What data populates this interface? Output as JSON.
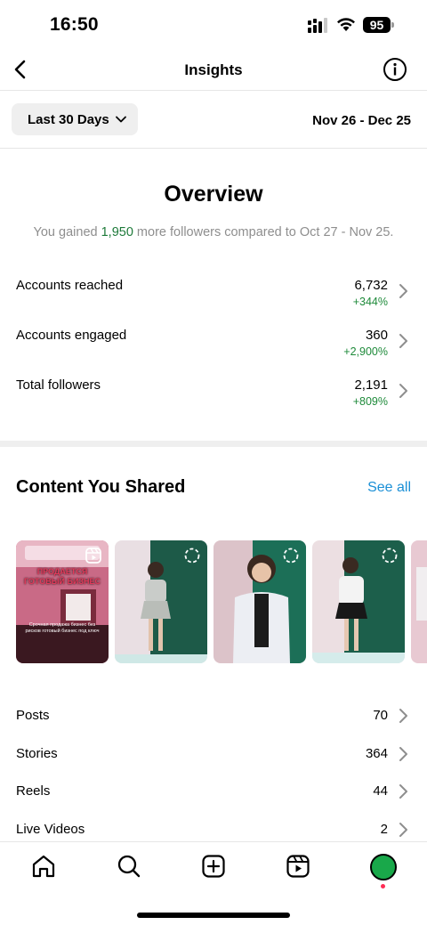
{
  "status_bar": {
    "time": "16:50",
    "battery": "95"
  },
  "header": {
    "title": "Insights"
  },
  "filter": {
    "range_label": "Last 30 Days",
    "date_range": "Nov 26 - Dec 25"
  },
  "overview": {
    "title": "Overview",
    "sub_prefix": "You gained ",
    "sub_highlight": "1,950",
    "sub_suffix": " more followers compared to Oct 27 - Nov 25.",
    "metrics": [
      {
        "label": "Accounts reached",
        "value": "6,732",
        "change": "+344%"
      },
      {
        "label": "Accounts engaged",
        "value": "360",
        "change": "+2,900%"
      },
      {
        "label": "Total followers",
        "value": "2,191",
        "change": "+809%"
      }
    ]
  },
  "content_shared": {
    "title": "Content You Shared",
    "see_all": "See all",
    "promo_text": "ПРОДАЕТСЯ ГОТОВЫЙ БИЗНЕС",
    "promo_caption": "Срочная продажа бизнес без рисков готовый бизнес под ключ",
    "counts": [
      {
        "label": "Posts",
        "value": "70"
      },
      {
        "label": "Stories",
        "value": "364"
      },
      {
        "label": "Reels",
        "value": "44"
      },
      {
        "label": "Live Videos",
        "value": "2"
      }
    ]
  },
  "tab_bar": {
    "icons": [
      "home-icon",
      "search-icon",
      "create-icon",
      "reels-icon",
      "profile-avatar"
    ]
  },
  "colors": {
    "accent_blue": "#1a8fd6",
    "positive_green": "#1e8a3a",
    "avatar_green": "#19a84a"
  }
}
